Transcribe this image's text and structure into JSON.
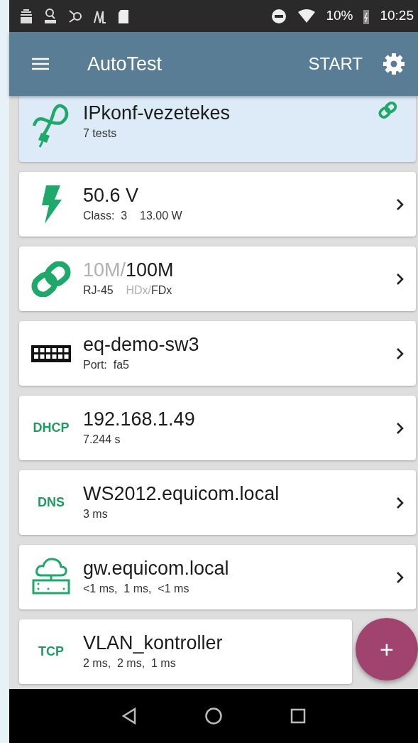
{
  "status_bar": {
    "battery": "10%",
    "time": "10:25"
  },
  "app_bar": {
    "title": "AutoTest",
    "action": "START"
  },
  "profile": {
    "title": "IPkonf-vezetekes",
    "subtitle": "7 tests",
    "linked": true
  },
  "rows": [
    {
      "kind": "power",
      "title": [
        {
          "text": "50.6 V",
          "dim": false
        }
      ],
      "subtitle": [
        {
          "text": "Class:  3    13.00 W",
          "dim": false
        }
      ]
    },
    {
      "kind": "link",
      "title": [
        {
          "text": "10M/",
          "dim": true
        },
        {
          "text": "100M",
          "dim": false
        }
      ],
      "subtitle": [
        {
          "text": "RJ-45    ",
          "dim": false
        },
        {
          "text": "HDx/",
          "dim": true
        },
        {
          "text": "FDx",
          "dim": false
        }
      ]
    },
    {
      "kind": "switch",
      "title": [
        {
          "text": "eq-demo-sw3",
          "dim": false
        }
      ],
      "subtitle": [
        {
          "text": "Port:  fa5",
          "dim": false
        }
      ]
    },
    {
      "kind": "tag",
      "tag": "DHCP",
      "title": [
        {
          "text": "192.168.1.49",
          "dim": false
        }
      ],
      "subtitle": [
        {
          "text": "7.244 s",
          "dim": false
        }
      ]
    },
    {
      "kind": "tag",
      "tag": "DNS",
      "title": [
        {
          "text": "WS2012.equicom.local",
          "dim": false
        }
      ],
      "subtitle": [
        {
          "text": "3 ms",
          "dim": false
        }
      ]
    },
    {
      "kind": "gateway",
      "title": [
        {
          "text": "gw.equicom.local",
          "dim": false
        }
      ],
      "subtitle": [
        {
          "text": "<1 ms,  1 ms,  <1 ms",
          "dim": false
        }
      ]
    },
    {
      "kind": "tag",
      "tag": "TCP",
      "title": [
        {
          "text": "VLAN_kontroller",
          "dim": false
        }
      ],
      "subtitle": [
        {
          "text": "2 ms,  2 ms,  1 ms",
          "dim": false
        }
      ]
    }
  ],
  "fab": {
    "label": "+"
  }
}
